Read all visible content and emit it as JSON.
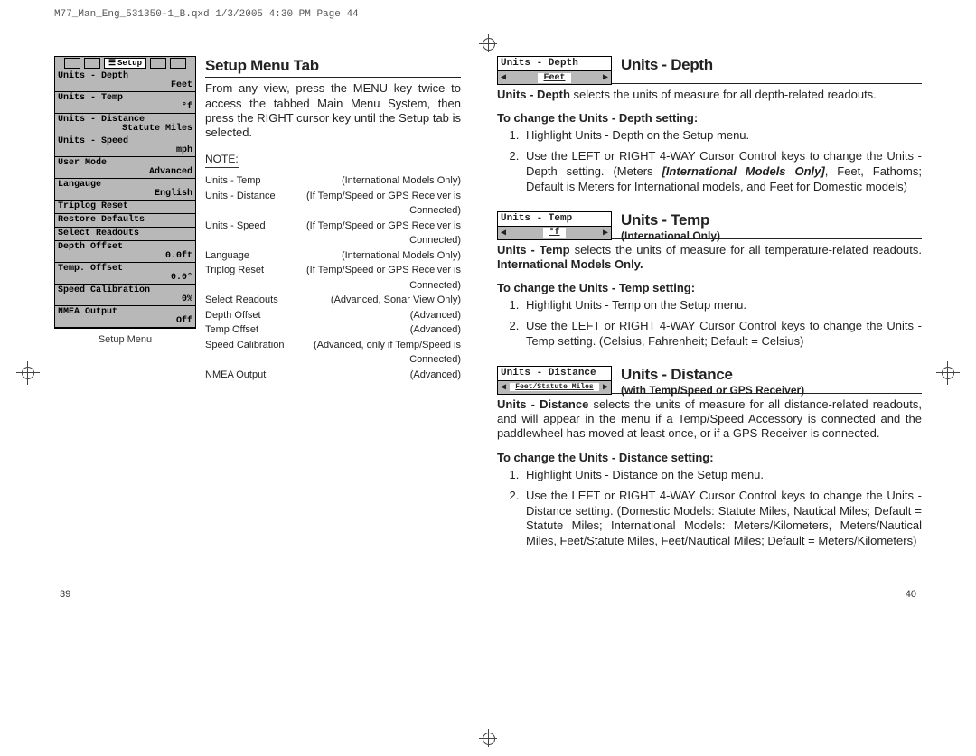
{
  "header": "M77_Man_Eng_531350-1_B.qxd  1/3/2005  4:30 PM  Page 44",
  "menu": {
    "tab_label": "Setup",
    "caption": "Setup Menu",
    "rows": [
      {
        "label": "Units - Depth",
        "value": "Feet"
      },
      {
        "label": "Units - Temp",
        "value": "°f"
      },
      {
        "label": "Units - Distance",
        "value": "Statute Miles"
      },
      {
        "label": "Units - Speed",
        "value": "mph"
      },
      {
        "label": "User Mode",
        "value": "Advanced"
      },
      {
        "label": "Langauge",
        "value": "English"
      },
      {
        "label": "Triplog Reset",
        "value": ""
      },
      {
        "label": "Restore Defaults",
        "value": ""
      },
      {
        "label": "Select Readouts",
        "value": ""
      },
      {
        "label": "Depth Offset",
        "value": "0.0ft"
      },
      {
        "label": "Temp. Offset",
        "value": "0.0°"
      },
      {
        "label": "Speed Calibration",
        "value": "0%"
      },
      {
        "label": "NMEA Output",
        "value": "Off"
      }
    ]
  },
  "left": {
    "title": "Setup Menu Tab",
    "intro": "From any view, press the MENU key twice to access the tabbed Main Menu System, then press the RIGHT cursor key until the Setup tab is selected.",
    "note_label": "NOTE",
    "notes": [
      {
        "k": "Units - Temp",
        "v": "(International Models Only)"
      },
      {
        "k": "Units - Distance",
        "v": "(If Temp/Speed or GPS Receiver is Connected)"
      },
      {
        "k": "Units - Speed",
        "v": "(If Temp/Speed or GPS Receiver is Connected)"
      },
      {
        "k": "Language",
        "v": "(International Models Only)"
      },
      {
        "k": "Triplog Reset",
        "v": "(If Temp/Speed or GPS Receiver is Connected)"
      },
      {
        "k": "Select Readouts",
        "v": "(Advanced, Sonar View Only)"
      },
      {
        "k": "Depth Offset",
        "v": "(Advanced)"
      },
      {
        "k": "Temp Offset",
        "v": "(Advanced)"
      },
      {
        "k": "Speed Calibration",
        "v": "(Advanced, only if Temp/Speed is Connected)"
      },
      {
        "k": "NMEA Output",
        "v": "(Advanced)"
      }
    ]
  },
  "sections": {
    "depth": {
      "widget_title": "Units - Depth",
      "widget_value": "Feet",
      "title": "Units - Depth",
      "body_lead": "Units - Depth",
      "body_rest": " selects the units of measure for all depth-related readouts.",
      "steps_hd": "To change the Units - Depth setting:",
      "steps": [
        "Highlight Units - Depth on the Setup menu.",
        "Use the LEFT or RIGHT 4-WAY Cursor Control keys to change the Units - Depth setting. (Meters [International Models Only], Feet, Fathoms; Default is Meters for International models, and Feet for Domestic models)"
      ],
      "intl_label": "[International Models Only]"
    },
    "temp": {
      "widget_title": "Units - Temp",
      "widget_value": "°f",
      "title": "Units - Temp",
      "subtitle": "(International Only)",
      "body_lead": "Units - Temp",
      "body_rest": " selects the units of measure for all temperature-related readouts. ",
      "body_bold2": "International Models Only.",
      "steps_hd": "To change the Units - Temp setting:",
      "steps": [
        "Highlight Units - Temp on the Setup menu.",
        "Use the LEFT or RIGHT 4-WAY Cursor Control keys to change the Units - Temp setting. (Celsius, Fahrenheit; Default = Celsius)"
      ]
    },
    "dist": {
      "widget_title": "Units - Distance",
      "widget_value": "Feet/Statute Miles",
      "title": "Units - Distance",
      "subtitle": "(with Temp/Speed or GPS Receiver)",
      "body_lead": "Units - Distance",
      "body_rest": " selects the units of measure for all distance-related readouts, and will appear in the menu if a Temp/Speed Accessory is connected and the paddlewheel has moved at least once, or if a GPS Receiver is connected.",
      "steps_hd": "To change the Units - Distance setting:",
      "steps": [
        "Highlight Units - Distance on the Setup menu.",
        "Use the LEFT or RIGHT 4-WAY Cursor Control keys to change the Units - Distance setting. (Domestic Models: Statute Miles, Nautical Miles; Default = Statute Miles; International Models: Meters/Kilometers, Meters/Nautical Miles, Feet/Statute Miles, Feet/Nautical Miles; Default = Meters/Kilometers)"
      ]
    }
  },
  "pagenums": {
    "left": "39",
    "right": "40"
  }
}
